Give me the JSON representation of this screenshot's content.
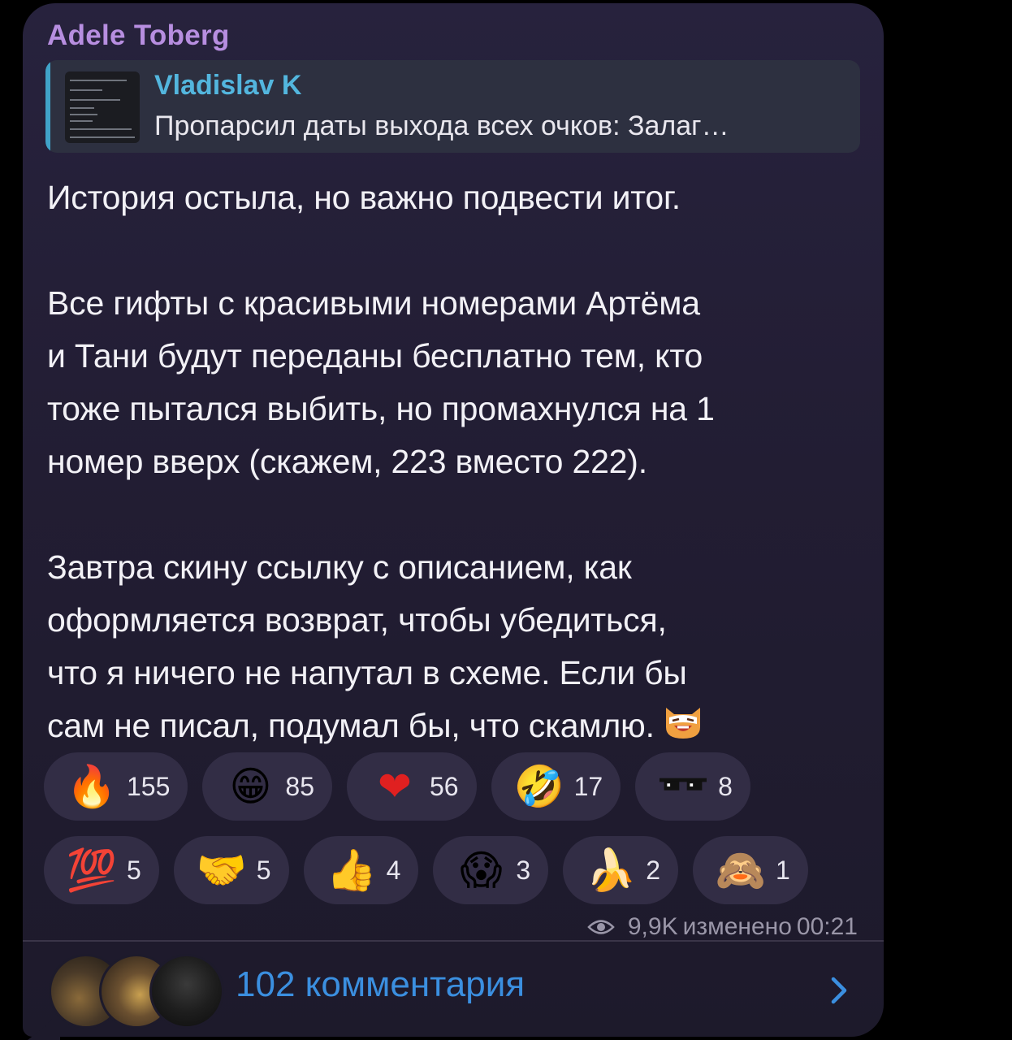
{
  "post": {
    "author": "Adele Toberg",
    "reply": {
      "name": "Vladislav K",
      "text": "Пропарсил даты выхода всех очков: Залаг…"
    },
    "message": {
      "line1": "История остыла, но важно подвести итог.",
      "line2": "Все гифты с красивыми номерами Артёма",
      "line3": "и Тани будут переданы бесплатно тем, кто",
      "line4": "тоже пытался выбить, но промахнулся на 1",
      "line5": "номер вверх (скажем, 223 вместо 222).",
      "line6": "Завтра скину ссылку с описанием, как",
      "line7": "оформляется возврат, чтобы убедиться,",
      "line8": "что я ничего не напутал в схеме. Если бы",
      "line9": "сам не писал, подумал бы, что скамлю."
    },
    "reactions_row1": [
      {
        "icon": "fire-icon",
        "glyph": "🔥",
        "count": "155"
      },
      {
        "icon": "grinning-face-icon",
        "glyph": "😁",
        "count": "85"
      },
      {
        "icon": "heart-icon",
        "glyph": "❤",
        "count": "56"
      },
      {
        "icon": "rolling-laughing-icon",
        "glyph": "🤣",
        "count": "17"
      },
      {
        "icon": "sunglasses-icon",
        "glyph": "",
        "count": "8"
      }
    ],
    "reactions_row2": [
      {
        "icon": "hundred-points-icon",
        "glyph": "💯",
        "count": "5"
      },
      {
        "icon": "handshake-icon",
        "glyph": "🤝",
        "count": "5"
      },
      {
        "icon": "thumbs-up-icon",
        "glyph": "👍",
        "count": "4"
      },
      {
        "icon": "screaming-face-icon",
        "glyph": "😱",
        "count": "3"
      },
      {
        "icon": "banana-icon",
        "glyph": "🍌",
        "count": "2"
      },
      {
        "icon": "see-no-evil-monkey-icon",
        "glyph": "🙈",
        "count": "1"
      }
    ],
    "meta": {
      "views": "9,9K",
      "edited": "изменено",
      "time": "00:21"
    },
    "comments": {
      "label": "102 комментария"
    }
  },
  "colors": {
    "author": "#b78ee0",
    "reply_name": "#53b6de",
    "comments_link": "#3b8fe0",
    "bubble": "#221d33"
  }
}
